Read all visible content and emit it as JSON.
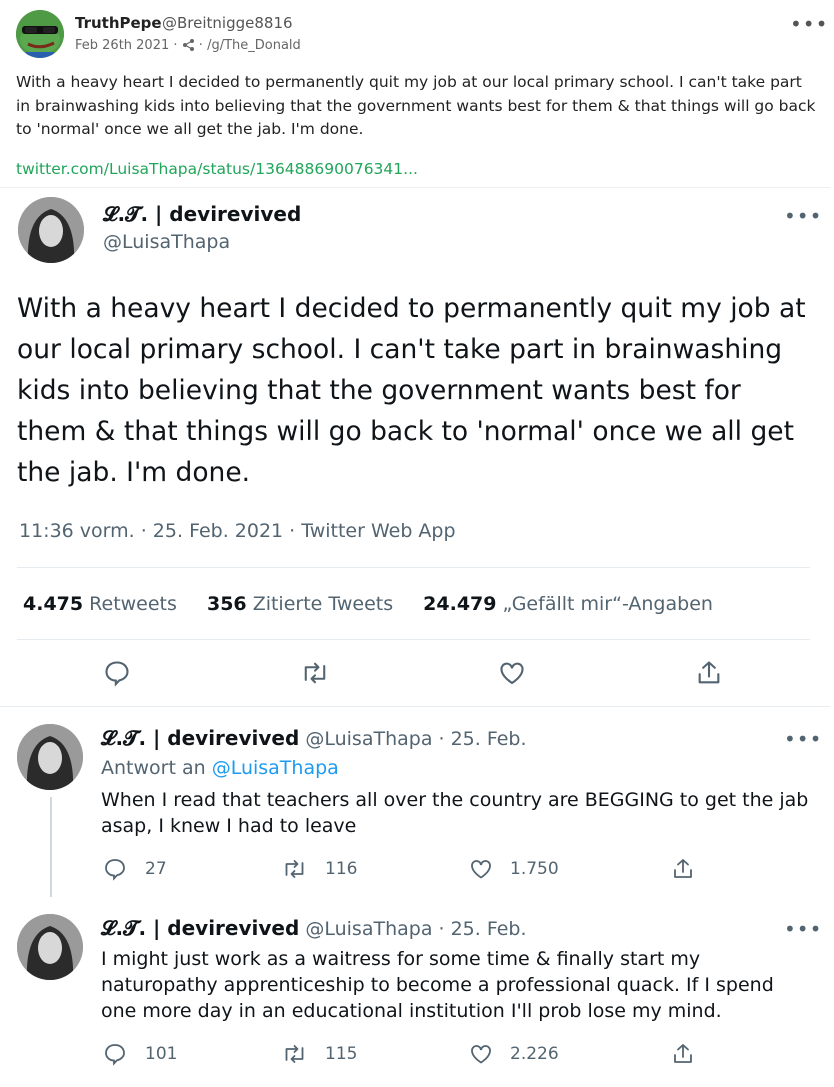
{
  "post": {
    "author_name": "TruthPepe",
    "author_handle": "@Breitnigge8816",
    "date": "Feb 26th 2021",
    "community": "/g/The_Donald",
    "more_label": "•••",
    "text": "With a heavy heart I decided to permanently quit my job at our local primary school. I can't take part in brainwashing kids into believing that the government wants best for them & that things will go back to 'normal' once we all get the jab. I'm done.",
    "link_text": "twitter.com/LuisaThapa/status/136488690076341..."
  },
  "tweet": {
    "display_name": "𝓛.𝓣. | devirevived",
    "handle": "@LuisaThapa",
    "text": "With a heavy heart I decided to permanently quit my job at our local primary school. I can't take part in brainwashing kids into believing that the government wants best for them & that things will go back to 'normal' once we all get the jab. I'm done.",
    "meta": "11:36 vorm. · 25. Feb. 2021 · Twitter Web App",
    "retweets_count": "4.475",
    "retweets_label": "Retweets",
    "quotes_count": "356",
    "quotes_label": "Zitierte Tweets",
    "likes_count": "24.479",
    "likes_label": "„Gefällt mir“-Angaben"
  },
  "replies": [
    {
      "display_name": "𝓛.𝓣. | devirevived",
      "handle_date": "@LuisaThapa · 25. Feb.",
      "reply_to_label": "Antwort an",
      "reply_to_mention": "@LuisaThapa",
      "text": "When I read that teachers all over the country are BEGGING to get the jab asap, I knew I had to leave",
      "reply_count": "27",
      "retweet_count": "116",
      "like_count": "1.750"
    },
    {
      "display_name": "𝓛.𝓣. | devirevived",
      "handle_date": "@LuisaThapa · 25. Feb.",
      "text": "I might just work as a waitress for some time & finally start my naturopathy apprenticeship to become a professional quack. If I spend one more day in an educational institution I'll prob lose my mind.",
      "reply_count": "101",
      "retweet_count": "115",
      "like_count": "2.226"
    }
  ],
  "colors": {
    "link_green": "#21a55a",
    "twitter_blue": "#1d9bf0",
    "muted_gray": "#536471",
    "pepe_green": "#3f8a3a"
  },
  "icons": [
    "pepe-avatar",
    "share-network-icon",
    "reply-icon",
    "retweet-icon",
    "like-icon",
    "share-icon",
    "more-icon"
  ]
}
